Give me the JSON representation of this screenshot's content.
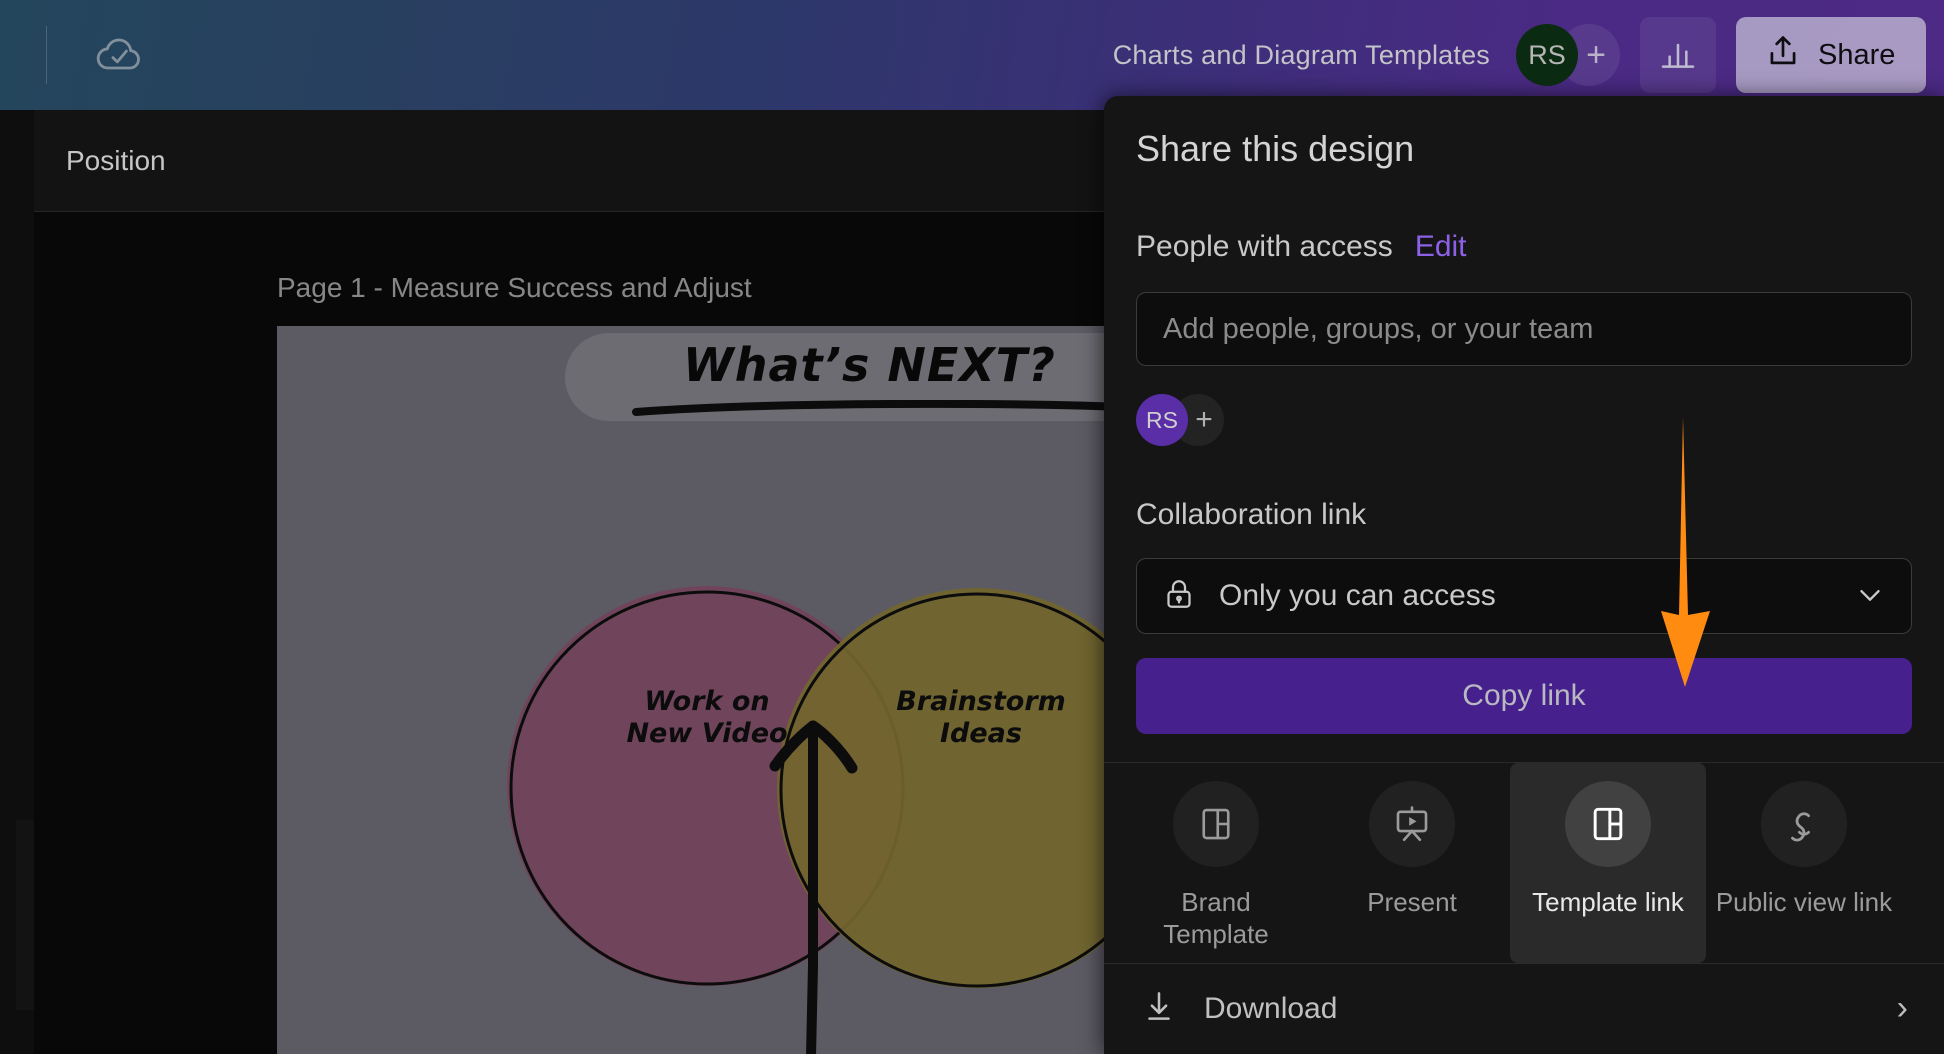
{
  "topbar": {
    "back_icon": "chevron-left-icon",
    "saved_icon": "cloud-check-icon",
    "doc_title": "Charts and Diagram Templates",
    "avatar_initials": "RS",
    "add_people_label": "+",
    "chart_icon": "bar-chart-icon",
    "share_label": "Share",
    "share_icon": "upload-icon"
  },
  "left_rail": {
    "collapse_icon": "chevron-left-icon"
  },
  "toolbar": {
    "position_label": "Position"
  },
  "canvas": {
    "page_label": "Page 1 - Measure Success and Adjust",
    "headline": "What’s NEXT?",
    "circles": [
      {
        "label": "Work on\nNew Video",
        "color": "#9a5d7c"
      },
      {
        "label": "Brainstorm\nIdeas",
        "color": "#9a8a3d"
      }
    ]
  },
  "share_panel": {
    "title": "Share this design",
    "people_label": "People with access",
    "edit_label": "Edit",
    "input_placeholder": "Add people, groups, or your team",
    "input_value": "",
    "avatar_initials": "RS",
    "avatar_add_label": "+",
    "collab_label": "Collaboration link",
    "access_icon": "lock-icon",
    "access_value": "Only you can access",
    "access_chevron": "chevron-down-icon",
    "copy_link_label": "Copy link",
    "tiles": [
      {
        "label": "Brand\nTemplate",
        "icon": "brand-template-icon",
        "selected": false
      },
      {
        "label": "Present",
        "icon": "present-icon",
        "selected": false
      },
      {
        "label": "Template link",
        "icon": "template-link-icon",
        "selected": true
      },
      {
        "label": "Public view link",
        "icon": "public-link-icon",
        "selected": false
      }
    ],
    "download_label": "Download",
    "download_icon": "download-icon",
    "download_chevron": "chevron-right-icon"
  },
  "annotation": {
    "arrow_icon": "down-arrow-annotation",
    "color": "#ff8c11"
  },
  "colors": {
    "accent_purple": "#46208c",
    "edit_link": "#8c61e8",
    "annotation_orange": "#ff8c11",
    "avatar_green": "#0b2a12",
    "avatar_purple": "#5a2ea6"
  }
}
